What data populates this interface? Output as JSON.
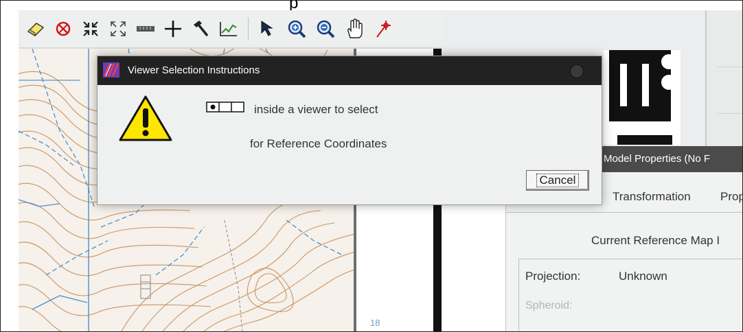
{
  "dialog": {
    "title": "Viewer Selection Instructions",
    "line1": "inside a viewer to select",
    "line2": "for Reference Coordinates",
    "cancel_label": "Cancel"
  },
  "model_properties": {
    "title": "Model Properties (No F",
    "tabs": [
      "Transformation",
      "Prop"
    ],
    "heading": "Current Reference Map I",
    "projection_label": "Projection:",
    "projection_value": "Unknown",
    "spheroid_label": "Spheroid:"
  },
  "map": {
    "label": "18"
  },
  "toolbar": {
    "icons": [
      "eraser-icon",
      "clear-icon",
      "shrink-icon",
      "expand-icon",
      "ruler-icon",
      "crosshair-icon",
      "hammer-icon",
      "profile-icon",
      "pointer-icon",
      "zoom-in-icon",
      "zoom-out-icon",
      "pan-hand-icon",
      "pin-icon"
    ]
  }
}
